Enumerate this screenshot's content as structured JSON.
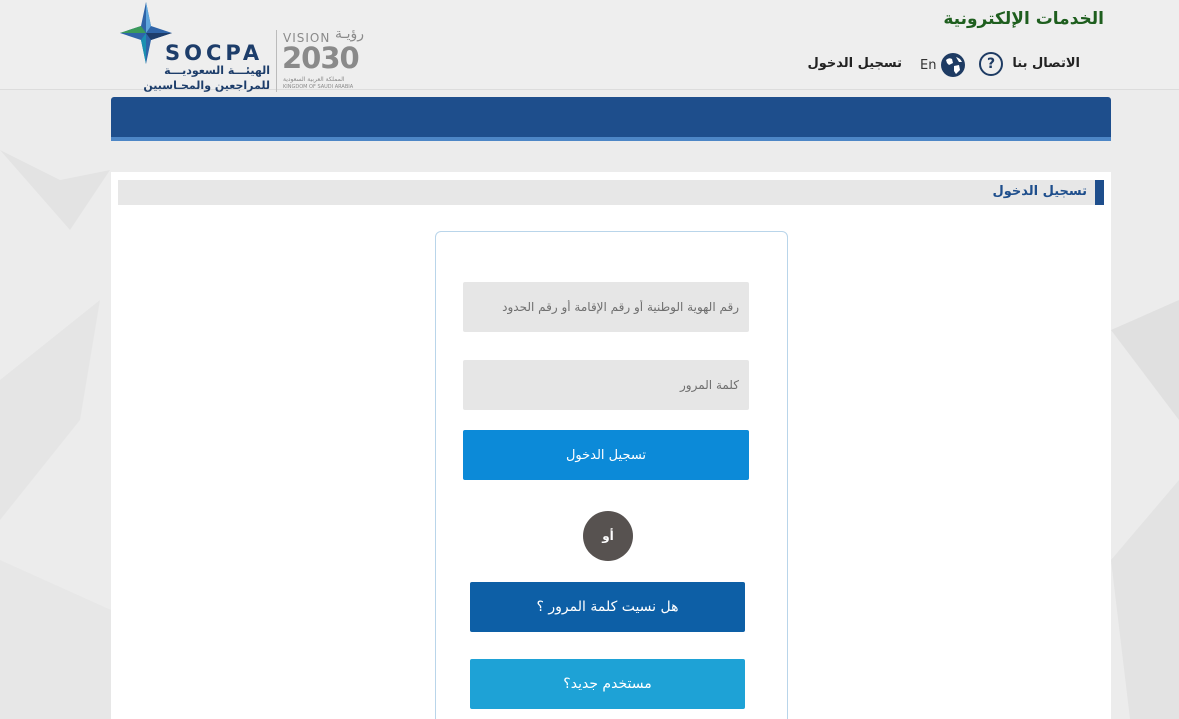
{
  "header": {
    "title": "الخدمات الإلكترونية",
    "nav": {
      "contact": "الاتصال بنا",
      "login": "تسجيل الدخول",
      "help_icon": "help-circle-icon",
      "help_glyph": "?",
      "globe_icon": "globe-icon",
      "lang": "En"
    }
  },
  "logos": {
    "socpa": {
      "word": "SOCPA",
      "arabic_line1": "الهيئـــة السعوديـــة",
      "arabic_line2": "للمراجعين والمحـاسبين",
      "brand_color": "#1d3d6a"
    },
    "vision": {
      "word": "VISION",
      "arabic": "رؤيـة",
      "year": "2030",
      "arabic_sub": "المملكة العربية السعودية",
      "english_sub": "KINGDOM OF SAUDI ARABIA"
    }
  },
  "section": {
    "title": "تسجيل الدخول"
  },
  "login_form": {
    "id_placeholder": "رقم الهوية الوطنية أو رقم الإقامة أو رقم الحدود",
    "password_placeholder": "كلمة المرور",
    "login_button": "تسجيل الدخول",
    "or_label": "أو",
    "forgot_button": "هل نسيت كلمة المرور ؟",
    "new_user_button": "مستخدم جديد؟"
  },
  "colors": {
    "header_title": "#1e5e1e",
    "blue_bar": "#1e4e8c",
    "login_button": "#0c8ad8",
    "forgot_button": "#0d5fa6",
    "new_user_button": "#1ea2d6",
    "or_circle": "#575250"
  }
}
